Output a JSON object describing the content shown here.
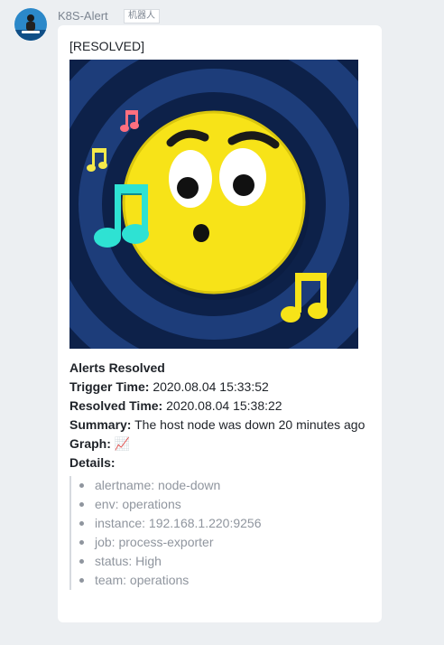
{
  "sender": {
    "name": "K8S-Alert",
    "tag": "机器人"
  },
  "message": {
    "status_line": "[RESOLVED]",
    "image_icon": "singing-emoji-music-notes",
    "heading": "Alerts Resolved",
    "fields": [
      {
        "label": "Trigger Time:",
        "value": " 2020.08.04 15:33:52"
      },
      {
        "label": "Resolved Time:",
        "value": " 2020.08.04 15:38:22"
      },
      {
        "label": "Summary:",
        "value": " The host node was down 20 minutes ago"
      },
      {
        "label": "Graph:",
        "value": " 📈"
      }
    ],
    "details_label": "Details:",
    "details": [
      "alertname: node-down",
      "env: operations",
      "instance: 192.168.1.220:9256",
      "job: process-exporter",
      "status: High",
      "team: operations"
    ]
  },
  "colors": {
    "background": "#eceff2",
    "bubble": "#ffffff",
    "text": "#1f2329",
    "muted": "#8f959e",
    "image_ring_dark": "#0d2149",
    "image_ring_light": "#1d3d7a",
    "emoji_yellow": "#f7e318"
  }
}
